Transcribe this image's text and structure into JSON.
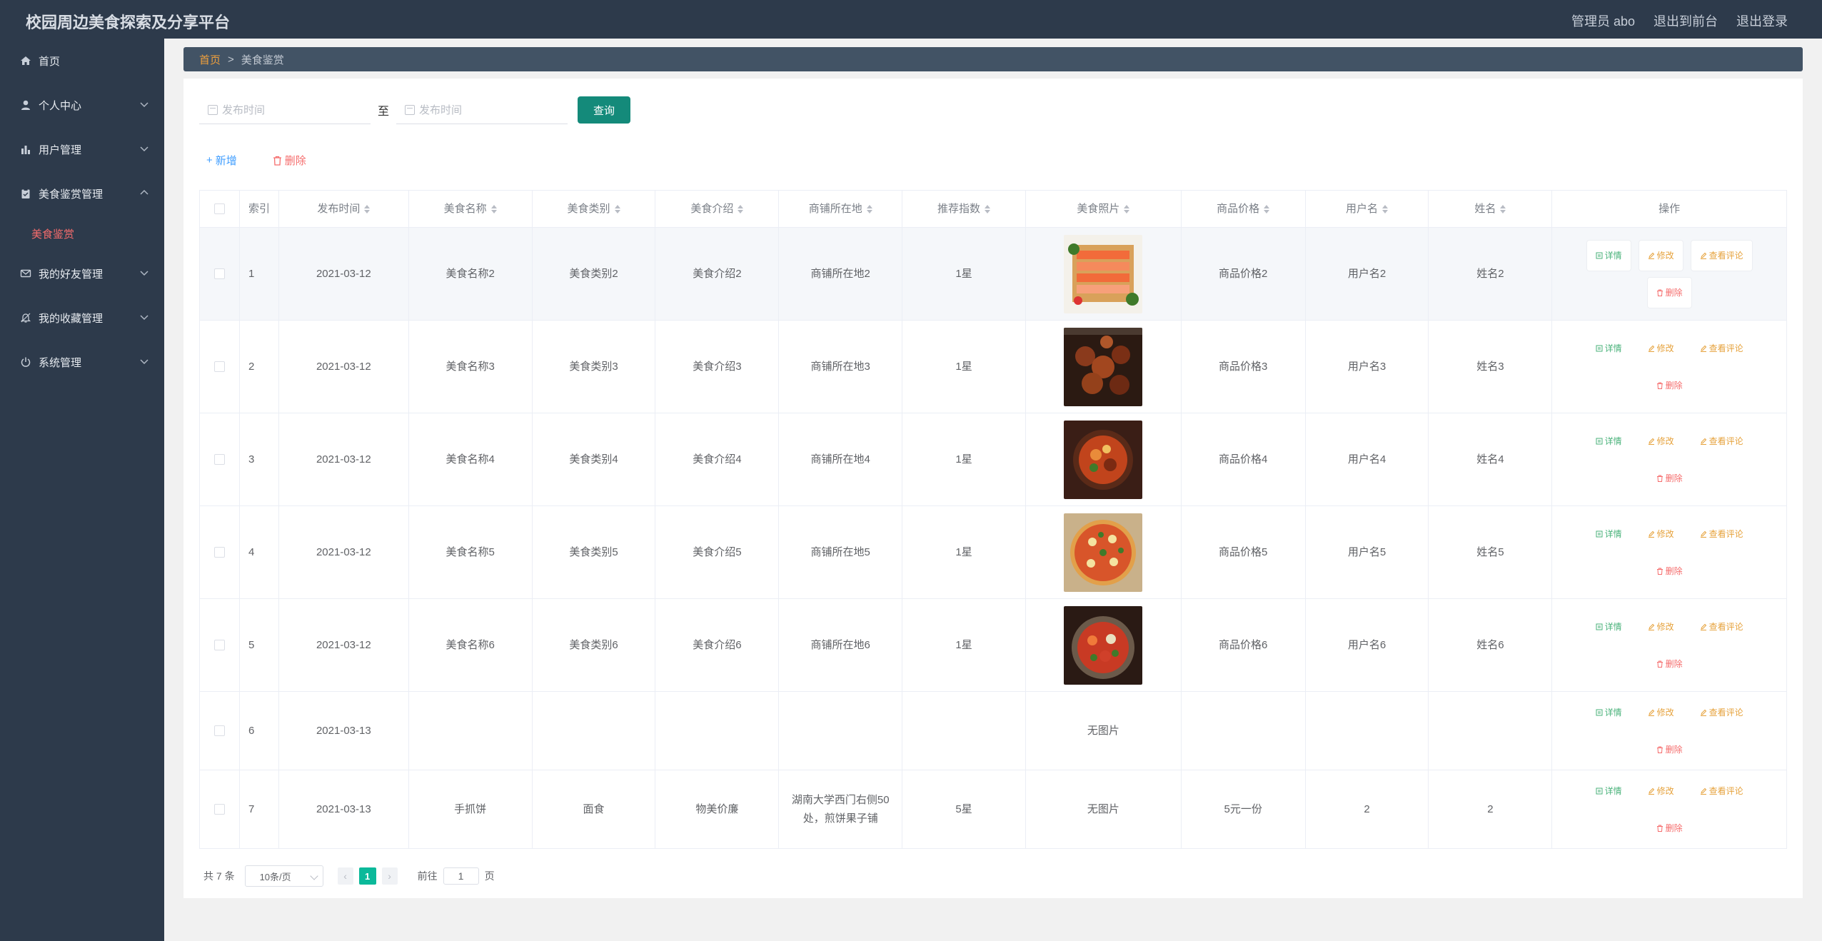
{
  "app": {
    "title": "校园周边美食探索及分享平台"
  },
  "header": {
    "admin": "管理员 abo",
    "to_front": "退出到前台",
    "logout": "退出登录"
  },
  "sidebar": {
    "items": [
      {
        "label": "首页",
        "icon": "home-icon"
      },
      {
        "label": "个人中心",
        "icon": "user-icon"
      },
      {
        "label": "用户管理",
        "icon": "bar-chart-icon"
      },
      {
        "label": "美食鉴赏管理",
        "icon": "clipboard-icon",
        "expanded": true
      },
      {
        "label": "我的好友管理",
        "icon": "mail-icon"
      },
      {
        "label": "我的收藏管理",
        "icon": "bell-icon"
      },
      {
        "label": "系统管理",
        "icon": "power-icon"
      }
    ],
    "sub_active": "美食鉴赏"
  },
  "breadcrumb": {
    "home": "首页",
    "separator": ">",
    "current": "美食鉴赏"
  },
  "filter": {
    "start_placeholder": "发布时间",
    "to": "至",
    "end_placeholder": "发布时间",
    "query_label": "查询"
  },
  "actions": {
    "add_label": "新增",
    "delete_label": "删除"
  },
  "table": {
    "headers": [
      "索引",
      "发布时间",
      "美食名称",
      "美食类别",
      "美食介绍",
      "商铺所在地",
      "推荐指数",
      "美食照片",
      "商品价格",
      "用户名",
      "姓名",
      "操作"
    ],
    "op_labels": {
      "detail": "详情",
      "edit": "修改",
      "review": "查看评论",
      "delete": "删除"
    },
    "rows": [
      {
        "index": "1",
        "date": "2021-03-12",
        "name": "美食名称2",
        "category": "美食类别2",
        "intro": "美食介绍2",
        "shop": "商铺所在地2",
        "rating": "1星",
        "photo": "sashimi",
        "price": "商品价格2",
        "username": "用户名2",
        "realname": "姓名2"
      },
      {
        "index": "2",
        "date": "2021-03-12",
        "name": "美食名称3",
        "category": "美食类别3",
        "intro": "美食介绍3",
        "shop": "商铺所在地3",
        "rating": "1星",
        "photo": "skewers",
        "price": "商品价格3",
        "username": "用户名3",
        "realname": "姓名3"
      },
      {
        "index": "3",
        "date": "2021-03-12",
        "name": "美食名称4",
        "category": "美食类别4",
        "intro": "美食介绍4",
        "shop": "商铺所在地4",
        "rating": "1星",
        "photo": "stew",
        "price": "商品价格4",
        "username": "用户名4",
        "realname": "姓名4"
      },
      {
        "index": "4",
        "date": "2021-03-12",
        "name": "美食名称5",
        "category": "美食类别5",
        "intro": "美食介绍5",
        "shop": "商铺所在地5",
        "rating": "1星",
        "photo": "pizza",
        "price": "商品价格5",
        "username": "用户名5",
        "realname": "姓名5"
      },
      {
        "index": "5",
        "date": "2021-03-12",
        "name": "美食名称6",
        "category": "美食类别6",
        "intro": "美食介绍6",
        "shop": "商铺所在地6",
        "rating": "1星",
        "photo": "chili-dish",
        "price": "商品价格6",
        "username": "用户名6",
        "realname": "姓名6"
      },
      {
        "index": "6",
        "date": "2021-03-13",
        "name": "",
        "category": "",
        "intro": "",
        "shop": "",
        "rating": "",
        "photo_text": "无图片",
        "price": "",
        "username": "",
        "realname": ""
      },
      {
        "index": "7",
        "date": "2021-03-13",
        "name": "手抓饼",
        "category": "面食",
        "intro": "物美价廉",
        "shop": "湖南大学西门右侧50处，煎饼果子铺",
        "rating": "5星",
        "photo_text": "无图片",
        "price": "5元一份",
        "username": "2",
        "realname": "2"
      }
    ]
  },
  "pagination": {
    "total": "共 7 条",
    "page_size": "10条/页",
    "prev": "‹",
    "current_page": "1",
    "next": "›",
    "goto_label": "前往",
    "goto_value": "1",
    "page_unit": "页"
  }
}
